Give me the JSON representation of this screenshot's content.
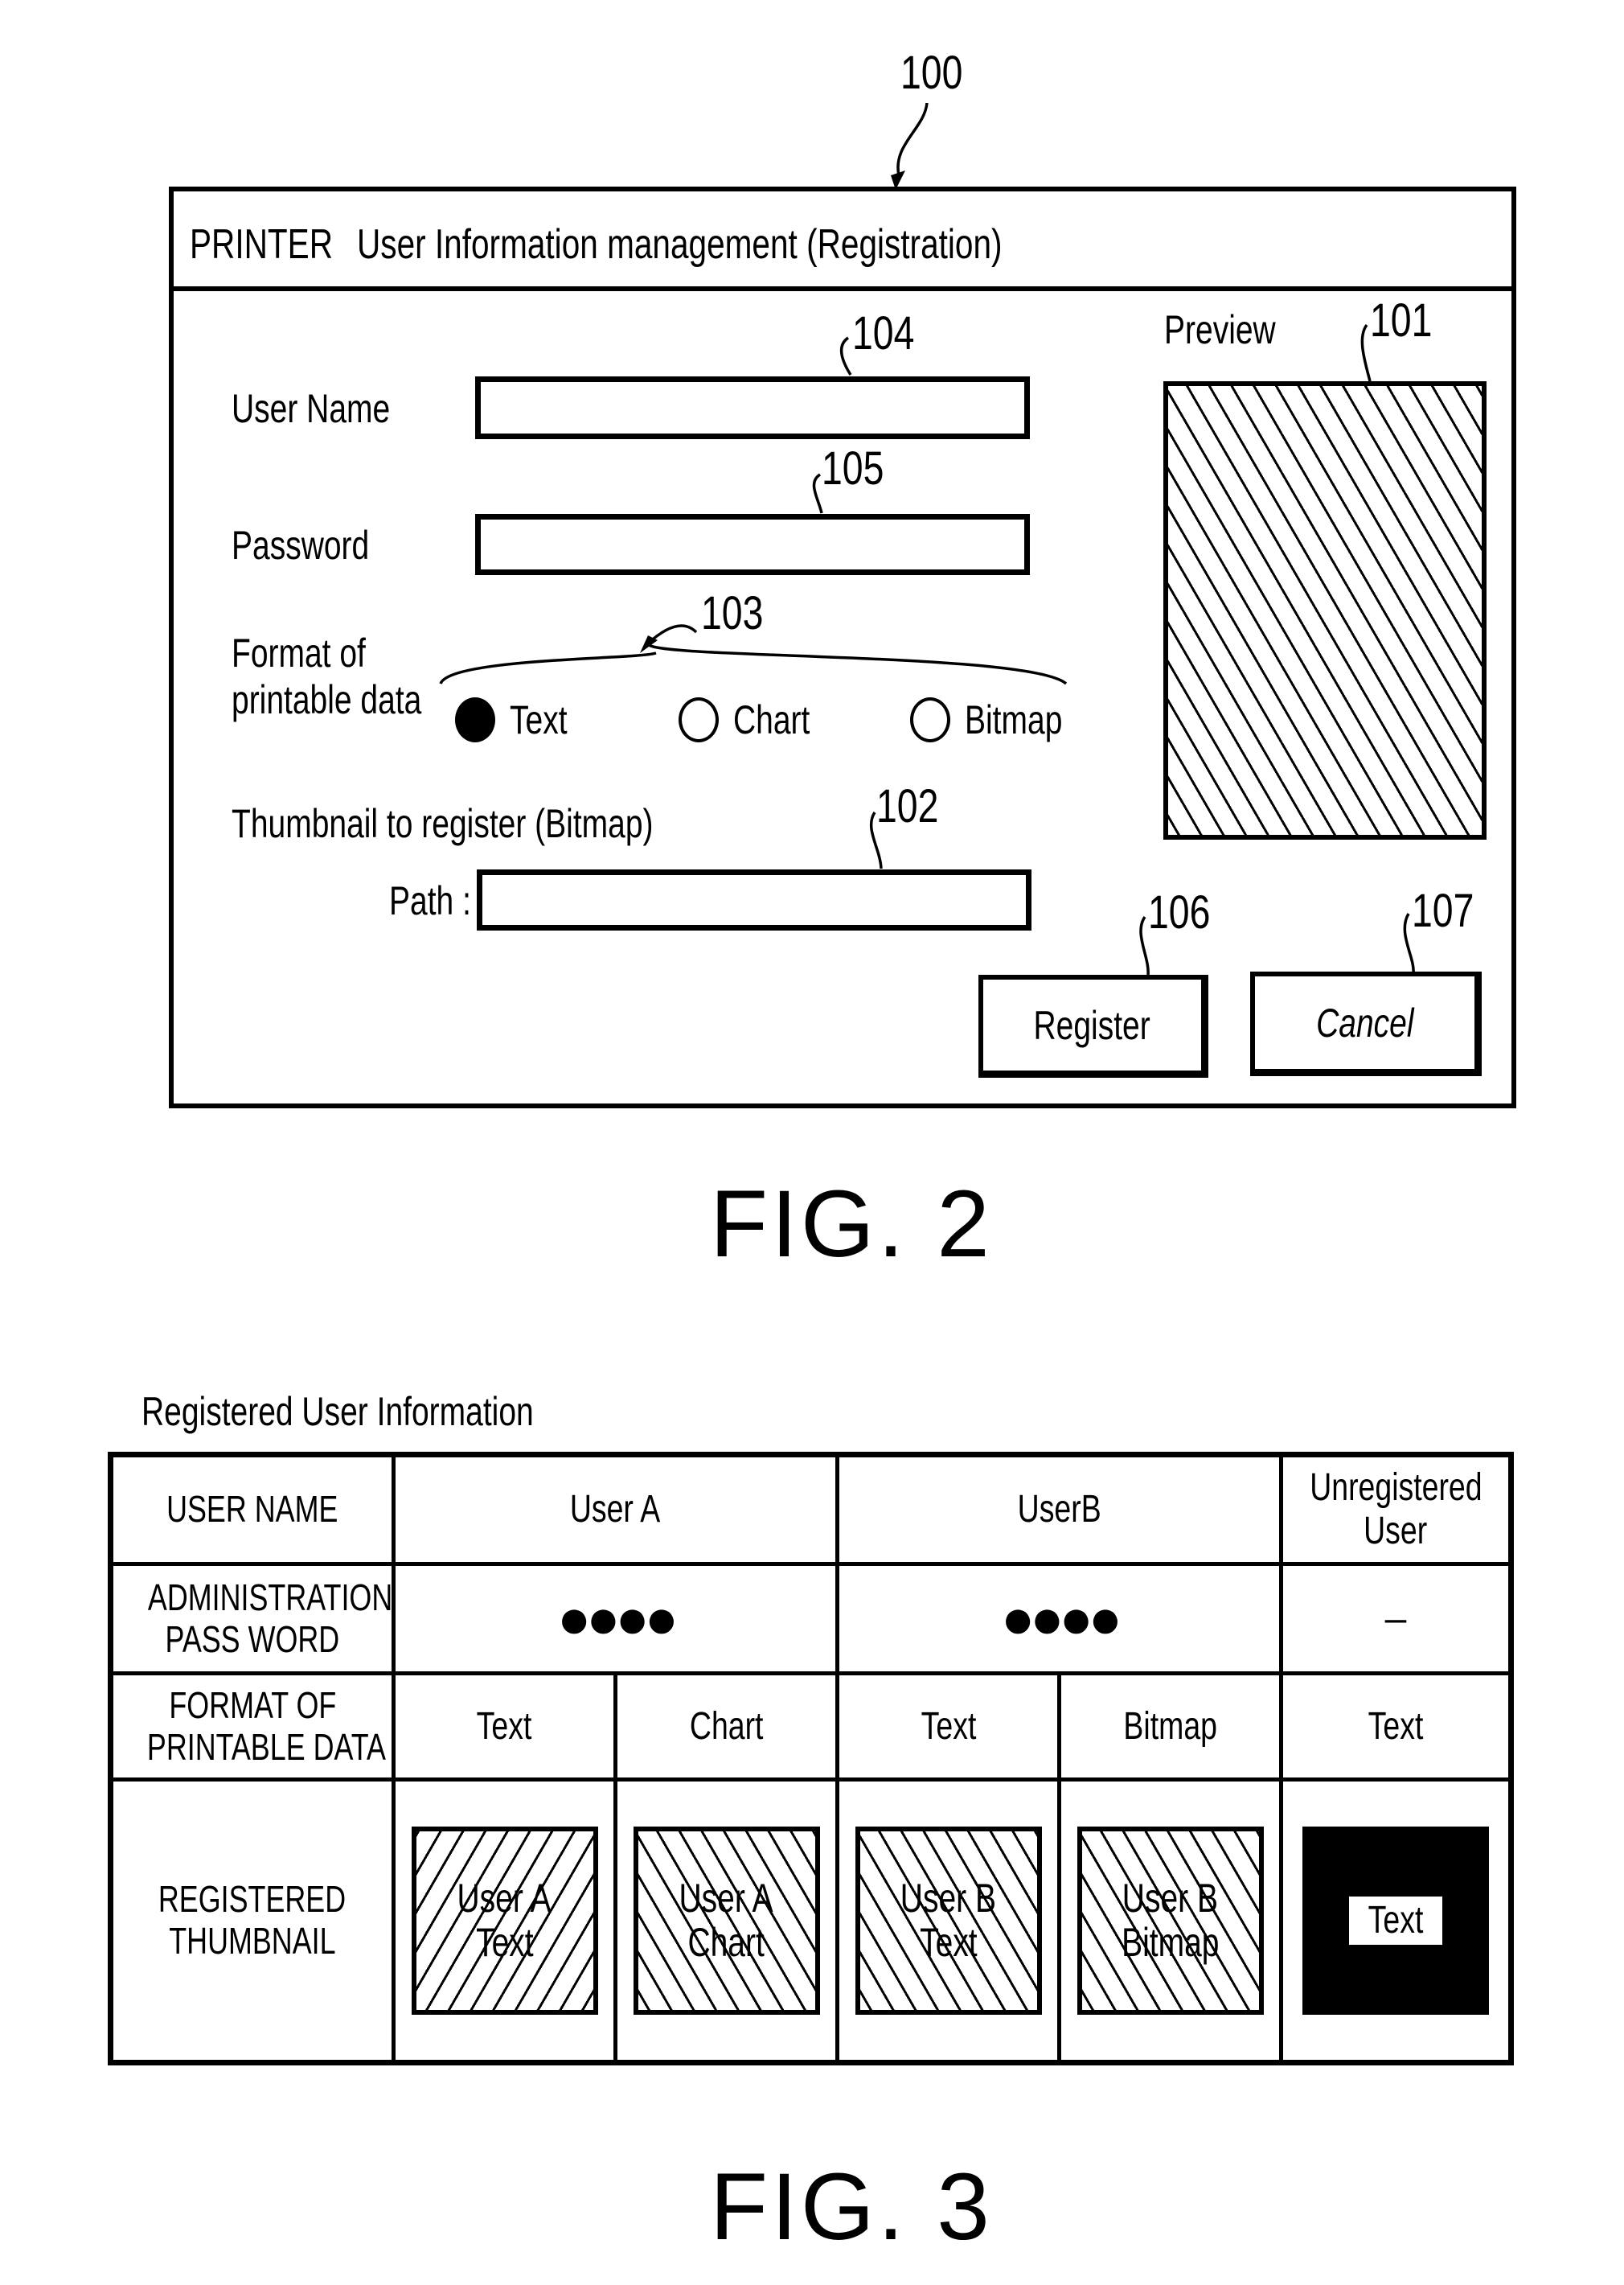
{
  "fig2": {
    "caption": "FIG. 2",
    "ref_dialog": "100",
    "dialog": {
      "app_label": "PRINTER",
      "title": "User Information management (Registration)",
      "user_name_label": "User Name",
      "user_name_value": "",
      "password_label": "Password",
      "password_value": "",
      "format_label_line1": "Format of",
      "format_label_line2": "printable data",
      "format_options": [
        {
          "label": "Text",
          "selected": true
        },
        {
          "label": "Chart",
          "selected": false
        },
        {
          "label": "Bitmap",
          "selected": false
        }
      ],
      "thumbnail_label": "Thumbnail to register (Bitmap)",
      "path_label": "Path :",
      "path_value": "",
      "preview_label": "Preview",
      "register_button": "Register",
      "cancel_button": "Cancel"
    },
    "refs": {
      "preview": "101",
      "path": "102",
      "format": "103",
      "user_name": "104",
      "password": "105",
      "register": "106",
      "cancel": "107"
    }
  },
  "fig3": {
    "caption": "FIG. 3",
    "title": "Registered User Information",
    "row_headers": {
      "user_name": "USER NAME",
      "password_line1": "ADMINISTRATION",
      "password_line2": "PASS WORD",
      "format_line1": "FORMAT OF",
      "format_line2": "PRINTABLE DATA",
      "thumb_line1": "REGISTERED",
      "thumb_line2": "THUMBNAIL"
    },
    "users": [
      {
        "name": "User A",
        "password": "●●●●"
      },
      {
        "name": "UserB",
        "password": "●●●●"
      },
      {
        "name_line1": "Unregistered",
        "name_line2": "User",
        "password": "–"
      }
    ],
    "formats": [
      "Text",
      "Chart",
      "Text",
      "Bitmap",
      "Text"
    ],
    "thumbnails": [
      {
        "line1": "User A",
        "line2": "Text"
      },
      {
        "line1": "User A",
        "line2": "Chart"
      },
      {
        "line1": "User B",
        "line2": "Text"
      },
      {
        "line1": "User B",
        "line2": "Bitmap"
      },
      {
        "line1": "Text",
        "line2": ""
      }
    ]
  }
}
